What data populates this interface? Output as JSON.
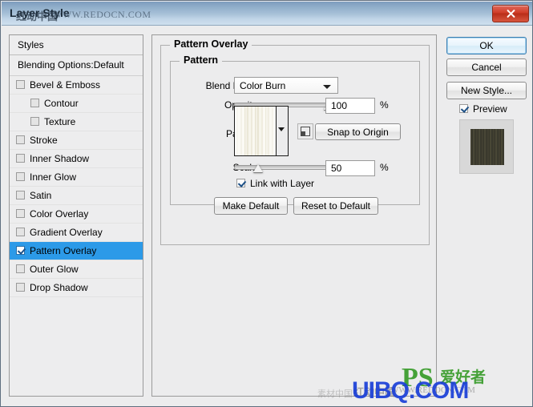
{
  "window": {
    "title": "Layer Style",
    "close_label": "close-window",
    "watermark_title_cn": "红动中国",
    "watermark_title_url": "WWW.REDOCN.COM"
  },
  "styles_panel": {
    "header": "Styles",
    "blending_options": "Blending Options:Default",
    "items": [
      {
        "label": "Bevel & Emboss",
        "checked": false,
        "indent": false,
        "selected": false
      },
      {
        "label": "Contour",
        "checked": false,
        "indent": true,
        "selected": false
      },
      {
        "label": "Texture",
        "checked": false,
        "indent": true,
        "selected": false
      },
      {
        "label": "Stroke",
        "checked": false,
        "indent": false,
        "selected": false
      },
      {
        "label": "Inner Shadow",
        "checked": false,
        "indent": false,
        "selected": false
      },
      {
        "label": "Inner Glow",
        "checked": false,
        "indent": false,
        "selected": false
      },
      {
        "label": "Satin",
        "checked": false,
        "indent": false,
        "selected": false
      },
      {
        "label": "Color Overlay",
        "checked": false,
        "indent": false,
        "selected": false
      },
      {
        "label": "Gradient Overlay",
        "checked": false,
        "indent": false,
        "selected": false
      },
      {
        "label": "Pattern Overlay",
        "checked": true,
        "indent": false,
        "selected": true
      },
      {
        "label": "Outer Glow",
        "checked": false,
        "indent": false,
        "selected": false
      },
      {
        "label": "Drop Shadow",
        "checked": false,
        "indent": false,
        "selected": false
      }
    ]
  },
  "main": {
    "group_title": "Pattern Overlay",
    "inner_group_title": "Pattern",
    "blend_mode": {
      "label": "Blend Mode:",
      "value": "Color Burn"
    },
    "opacity": {
      "label": "Opacity:",
      "value": "100",
      "unit": "%",
      "percent": 100
    },
    "pattern": {
      "label": "Pattern:",
      "swatch_name": "wood-grain-cream"
    },
    "snap_to_origin": "Snap to Origin",
    "new_pattern_icon": "new-pattern-icon",
    "scale": {
      "label": "Scale:",
      "value": "50",
      "unit": "%",
      "percent": 25
    },
    "link_with_layer": {
      "label": "Link with Layer",
      "checked": true
    },
    "make_default": "Make Default",
    "reset_to_default": "Reset to Default"
  },
  "actions": {
    "ok": "OK",
    "cancel": "Cancel",
    "new_style": "New Style...",
    "preview": {
      "label": "Preview",
      "checked": true
    },
    "preview_thumb": "dark-wood-swatch"
  },
  "watermarks": {
    "uibq": "UIBQ.COM",
    "ps": "PS",
    "ps_cn": "爱好者",
    "redocn_cn": "红动中国",
    "redocn_url": "WWW.REDOCN.COM",
    "mid_cn": "素材中国"
  },
  "colors": {
    "selection": "#2c9ae8",
    "title_bar": "#a9c2d9",
    "close": "#cf3c27",
    "dialog_bg": "#ececed"
  }
}
